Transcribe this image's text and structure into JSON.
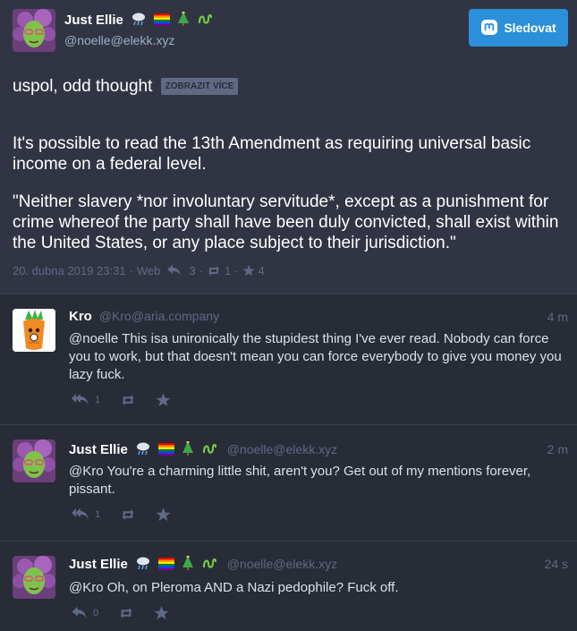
{
  "main_post": {
    "display_name": "Just Ellie",
    "handle": "@noelle@elekk.xyz",
    "follow_label": "Sledovat",
    "spoiler_text": "uspol, odd thought",
    "show_more_label": "ZOBRAZIT VÍCE",
    "paragraphs": [
      "It's possible to read the 13th Amendment as requiring universal basic income on a federal level.",
      "\"Neither slavery *nor involuntary servitude*, except as a punishment for crime whereof the party shall have been duly convicted, shall exist within the United States, or any place subject to their jurisdiction.\""
    ],
    "date": "20. dubna 2019 23:31",
    "separator": "·",
    "client": "Web",
    "replies": "3",
    "boosts": "1",
    "favourites": "4"
  },
  "replies": [
    {
      "display_name": "Kro",
      "handle": "@Kro@aria.company",
      "time": "4 m",
      "mention": "@noelle",
      "text": "This isa unironically the stupidest thing I've ever read. Nobody can force you to work, but that doesn't mean you can force everybody to give you money you lazy fuck.",
      "reply_count": "1"
    },
    {
      "display_name": "Just Ellie",
      "handle": "@noelle@elekk.xyz",
      "time": "2 m",
      "mention": "@Kro",
      "text": "You're a charming little shit, aren't you? Get out of my mentions forever, pissant.",
      "reply_count": "1"
    },
    {
      "display_name": "Just Ellie",
      "handle": "@noelle@elekk.xyz",
      "time": "24 s",
      "mention": "@Kro",
      "text": "Oh, on Pleroma AND a Nazi pedophile? Fuck off.",
      "reply_count": "0"
    }
  ],
  "colors": {
    "background": "#282c37",
    "main_post_bg": "#313543",
    "accent": "#2b90d9",
    "muted": "#606984",
    "link": "#d9e1e8"
  }
}
